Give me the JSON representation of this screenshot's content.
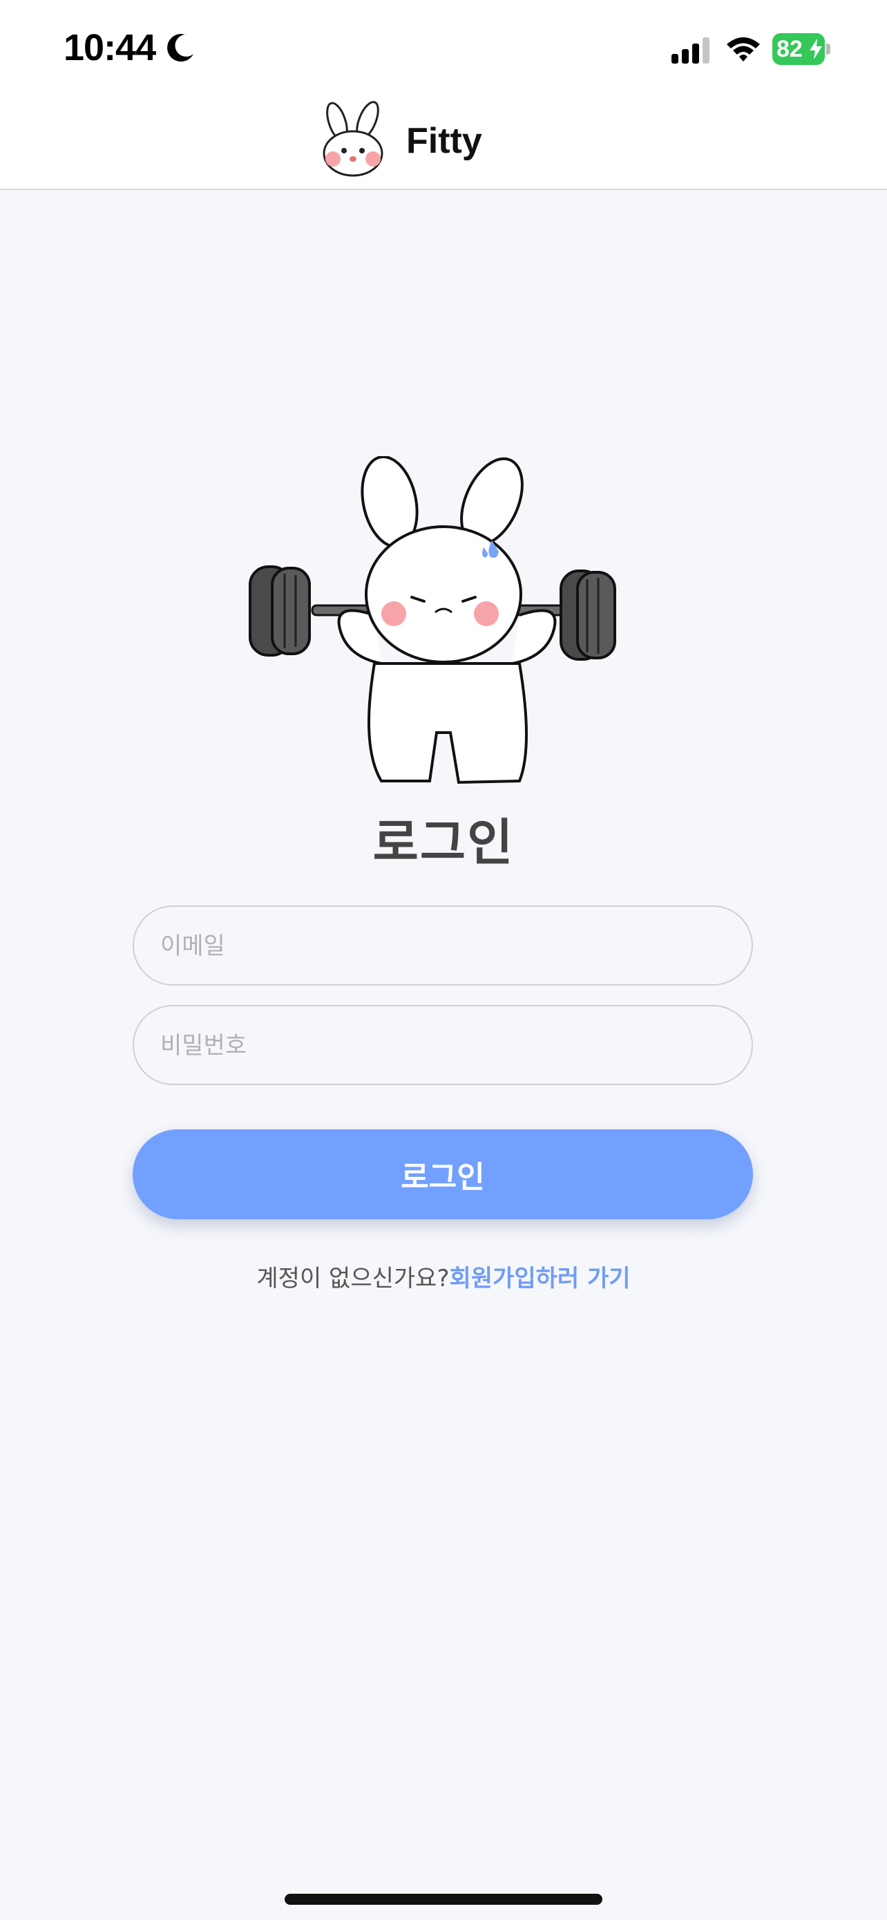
{
  "status_bar": {
    "time": "10:44",
    "battery_level": "82",
    "icons": [
      "moon-icon",
      "cellular-signal-icon",
      "wifi-icon",
      "battery-icon"
    ]
  },
  "header": {
    "title": "Fitty",
    "logo_icon": "bunny-logo-icon"
  },
  "hero": {
    "illustration": "bunny-lifting-barbell-icon"
  },
  "login": {
    "title": "로그인",
    "email_placeholder": "이메일",
    "email_value": "",
    "password_placeholder": "비밀번호",
    "password_value": "",
    "submit_label": "로그인"
  },
  "signup": {
    "prompt": "계정이 없으신가요?",
    "link_label": "회원가입하러 가기"
  },
  "colors": {
    "accent": "#72a0ff",
    "link": "#6f9cf5",
    "background": "#f6f7fb",
    "battery": "#34c759"
  }
}
